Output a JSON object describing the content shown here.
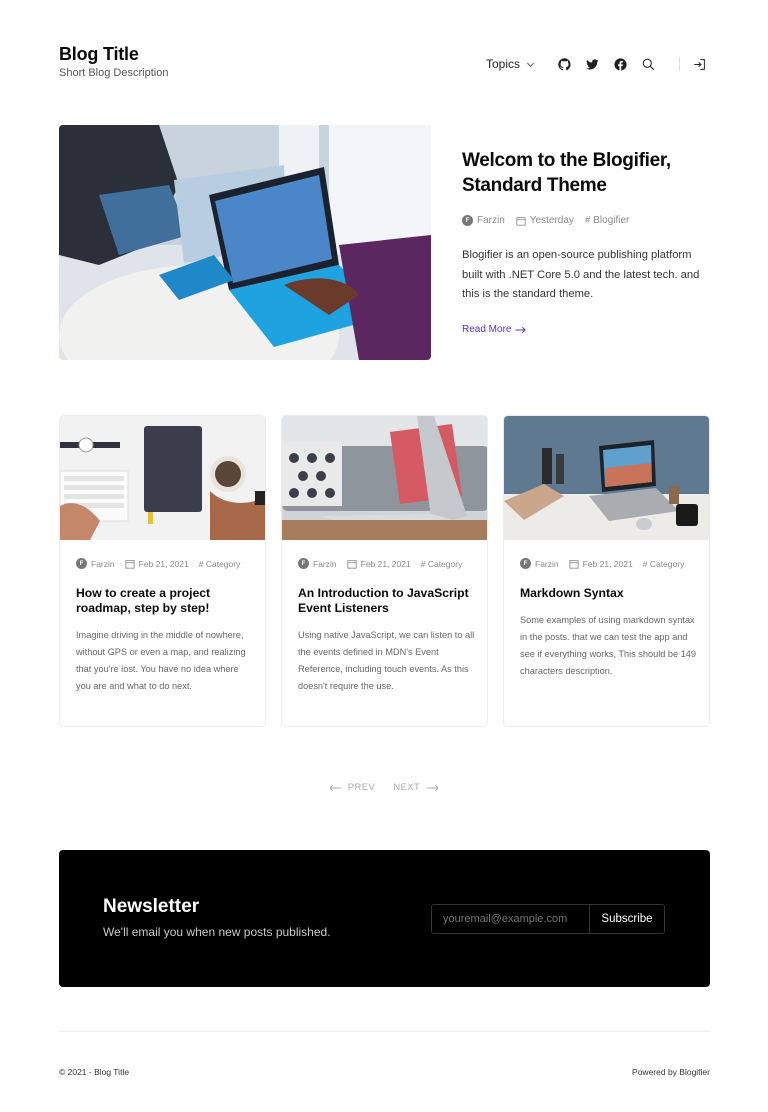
{
  "header": {
    "title": "Blog Title",
    "description": "Short Blog Description",
    "nav": {
      "topics_label": "Topics",
      "icons": [
        "github-icon",
        "twitter-icon",
        "facebook-icon",
        "search-icon",
        "login-icon"
      ]
    }
  },
  "hero": {
    "title": "Welcom to the Blogifier, Standard Theme",
    "author_initial": "F",
    "author": "Farzin",
    "date": "Yesterday",
    "category": "# Blogifier",
    "excerpt": "Blogifier is an open-source publishing platform built with .NET Core 5.0 and the latest tech. and this is the standard theme.",
    "read_more": "Read More"
  },
  "posts": [
    {
      "author_initial": "F",
      "author": "Farzin",
      "date": "Feb 21, 2021",
      "category": "# Category",
      "title": "How to create a project roadmap, step by step!",
      "excerpt": "Imagine driving in the middle of nowhere, without GPS or even a map, and realizing that you're lost. You have no idea where you are and what to do next."
    },
    {
      "author_initial": "F",
      "author": "Farzin",
      "date": "Feb 21, 2021",
      "category": "# Category",
      "title": "An Introduction to JavaScript Event Listeners",
      "excerpt": "Using native JavaScript, we can listen to all the events defined in MDN's Event Reference, including touch events. As this doesn't require the use."
    },
    {
      "author_initial": "F",
      "author": "Farzin",
      "date": "Feb 21, 2021",
      "category": "# Category",
      "title": "Markdown Syntax",
      "excerpt": "Some examples of using markdown syntax in the posts. that we can test the app and see if everything works, This should be 149 characters description."
    }
  ],
  "pagination": {
    "prev": "PREV",
    "next": "NEXT"
  },
  "newsletter": {
    "title": "Newsletter",
    "description": "We'll email you when new posts published.",
    "placeholder": "youremail@example.com",
    "button": "Subscribe"
  },
  "footer": {
    "copyright": "© 2021 - Blog Title",
    "powered_by": "Powered by Blogifier"
  },
  "colors": {
    "accent": "#5a2bd8",
    "newsletter_bg": "#000000",
    "text": "#111111"
  }
}
